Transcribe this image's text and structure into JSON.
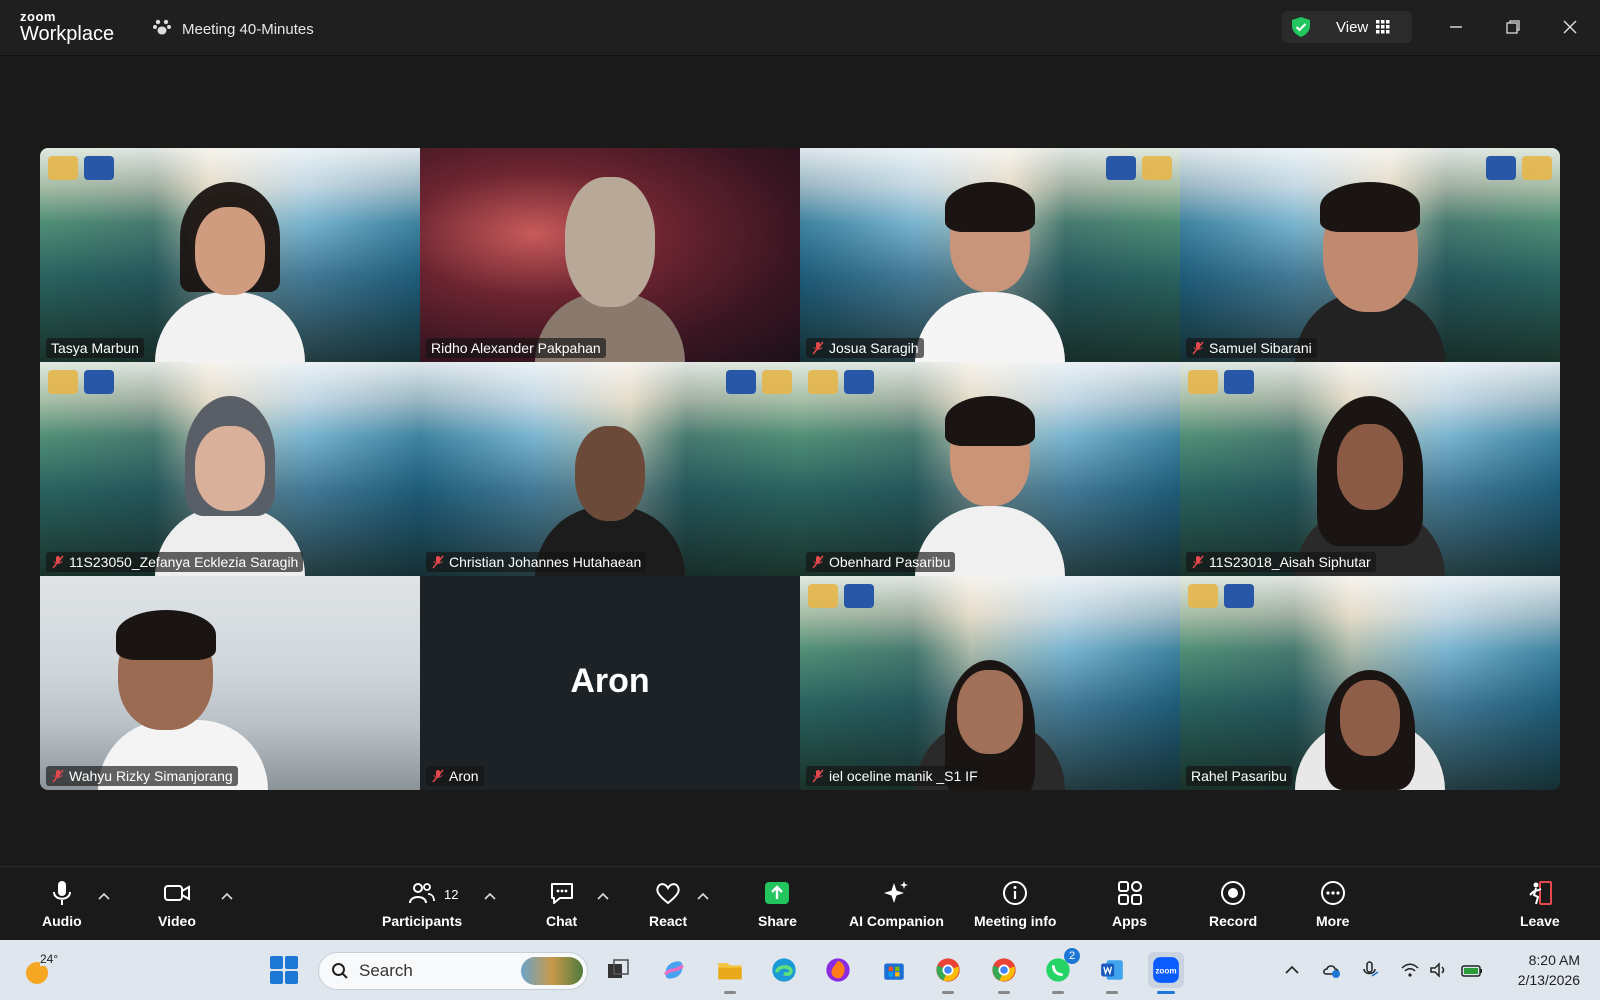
{
  "titlebar": {
    "brand_line1": "zoom",
    "brand_line2": "Workplace",
    "meeting_title": "Meeting 40-Minutes",
    "view_label": "View"
  },
  "participants": [
    {
      "name": "Tasya Marbun",
      "muted": false,
      "background": "campus"
    },
    {
      "name": "Ridho Alexander Pakpahan",
      "muted": false,
      "background": "red",
      "active_speaker": true
    },
    {
      "name": "Josua Saragih",
      "muted": true,
      "background": "campus-mirror"
    },
    {
      "name": "Samuel Sibarani",
      "muted": true,
      "background": "campus-mirror"
    },
    {
      "name": "11S23050_Zefanya Ecklezia Saragih",
      "muted": true,
      "background": "campus"
    },
    {
      "name": "Christian Johannes Hutahaean",
      "muted": true,
      "background": "campus-mirror"
    },
    {
      "name": "Obenhard Pasaribu",
      "muted": true,
      "background": "campus"
    },
    {
      "name": "11S23018_Aisah Siphutar",
      "muted": true,
      "background": "campus"
    },
    {
      "name": "Wahyu Rizky Simanjorang",
      "muted": true,
      "background": "room"
    },
    {
      "name": "Aron",
      "muted": true,
      "background": "none",
      "video_off_label": "Aron"
    },
    {
      "name": "iel oceline manik _S1 IF",
      "muted": true,
      "background": "campus"
    },
    {
      "name": "Rahel Pasaribu",
      "muted": false,
      "background": "campus"
    }
  ],
  "toolbar": {
    "audio": "Audio",
    "video": "Video",
    "participants": "Participants",
    "participants_count": "12",
    "chat": "Chat",
    "react": "React",
    "share": "Share",
    "ai_companion": "AI Companion",
    "meeting_info": "Meeting info",
    "apps": "Apps",
    "record": "Record",
    "more": "More",
    "leave": "Leave"
  },
  "taskbar": {
    "temperature": "24°",
    "search_placeholder": "Search",
    "whatsapp_badge": "2",
    "time": "8:20 AM",
    "date": "2/13/2026"
  },
  "colors": {
    "active_speaker_border": "#2ee56c",
    "share_green": "#22c55e",
    "leave_red": "#e5484d",
    "taskbar_bg": "#dfe6ee",
    "zoom_blue": "#0b5cff"
  }
}
